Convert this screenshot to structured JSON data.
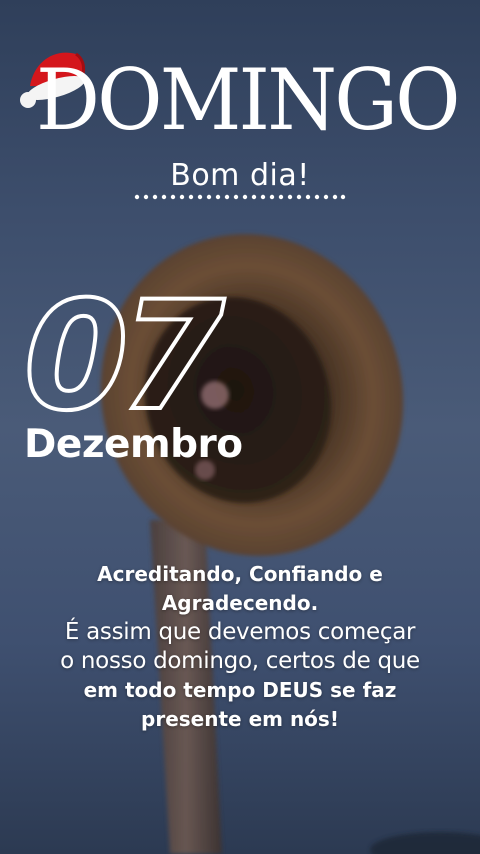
{
  "header": {
    "title": "DOMINGO",
    "greeting": "Bom dia!"
  },
  "date": {
    "day": "07",
    "month": "Dezembro"
  },
  "message": {
    "line1": "Acreditando, Confiando e",
    "line2": "Agradecendo.",
    "line3": "É assim que devemos começar",
    "line4": "o nosso domingo, certos de que",
    "line5": "em todo tempo DEUS se faz",
    "line6": "presente em nós!"
  },
  "colors": {
    "text": "#ffffff",
    "santa_hat_red": "#d4161c",
    "background": "#3a4a66"
  },
  "icons": {
    "hat_decoration": "santa-hat-icon"
  }
}
